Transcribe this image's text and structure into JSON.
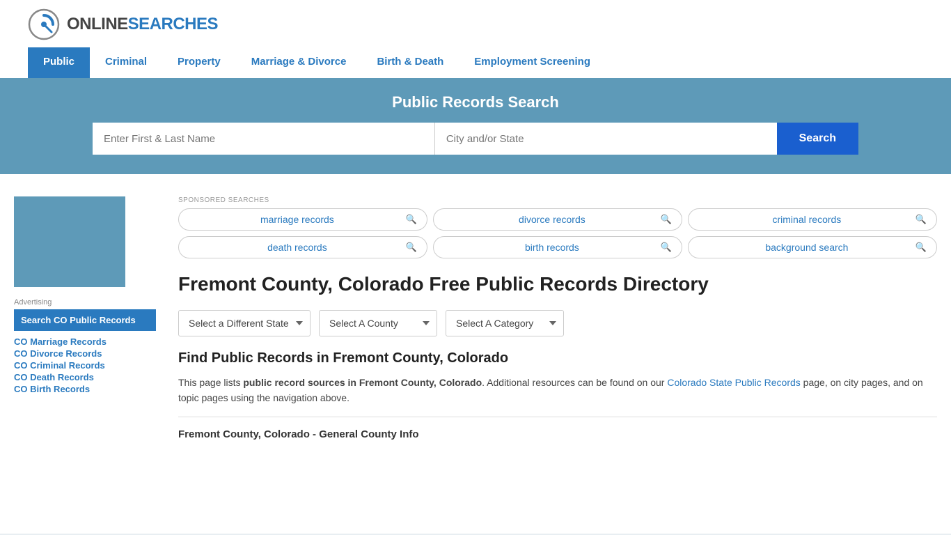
{
  "logo": {
    "online": "ONLINE",
    "searches": "SEARCHES",
    "alt": "OnlineSearches Logo"
  },
  "nav": {
    "items": [
      {
        "label": "Public",
        "active": true
      },
      {
        "label": "Criminal",
        "active": false
      },
      {
        "label": "Property",
        "active": false
      },
      {
        "label": "Marriage & Divorce",
        "active": false
      },
      {
        "label": "Birth & Death",
        "active": false
      },
      {
        "label": "Employment Screening",
        "active": false
      }
    ]
  },
  "hero": {
    "title": "Public Records Search",
    "name_placeholder": "Enter First & Last Name",
    "location_placeholder": "City and/or State",
    "search_button": "Search"
  },
  "sponsored": {
    "label": "SPONSORED SEARCHES",
    "pills": [
      {
        "text": "marriage records"
      },
      {
        "text": "divorce records"
      },
      {
        "text": "criminal records"
      },
      {
        "text": "death records"
      },
      {
        "text": "birth records"
      },
      {
        "text": "background search"
      }
    ]
  },
  "page_heading": "Fremont County, Colorado Free Public Records Directory",
  "dropdowns": {
    "state": "Select a Different State",
    "county": "Select A County",
    "category": "Select A Category"
  },
  "find_section": {
    "heading": "Find Public Records in Fremont County, Colorado",
    "description_before_link": "This page lists ",
    "bold_text": "public record sources in Fremont County, Colorado",
    "description_after_bold": ". Additional resources can be found on our ",
    "link_text": "Colorado State Public Records",
    "description_after_link": " page, on city pages, and on topic pages using the navigation above."
  },
  "county_info_heading": "Fremont County, Colorado - General County Info",
  "sidebar": {
    "ad_label": "Advertising",
    "ad_box": "Search CO Public Records",
    "links": [
      "CO Marriage Records",
      "CO Divorce Records",
      "CO Criminal Records",
      "CO Death Records",
      "CO Birth Records"
    ]
  },
  "colors": {
    "primary_blue": "#2a7abf",
    "hero_bg": "#5e9ab8",
    "search_btn": "#1a5fcf",
    "active_nav": "#2a7abf"
  }
}
